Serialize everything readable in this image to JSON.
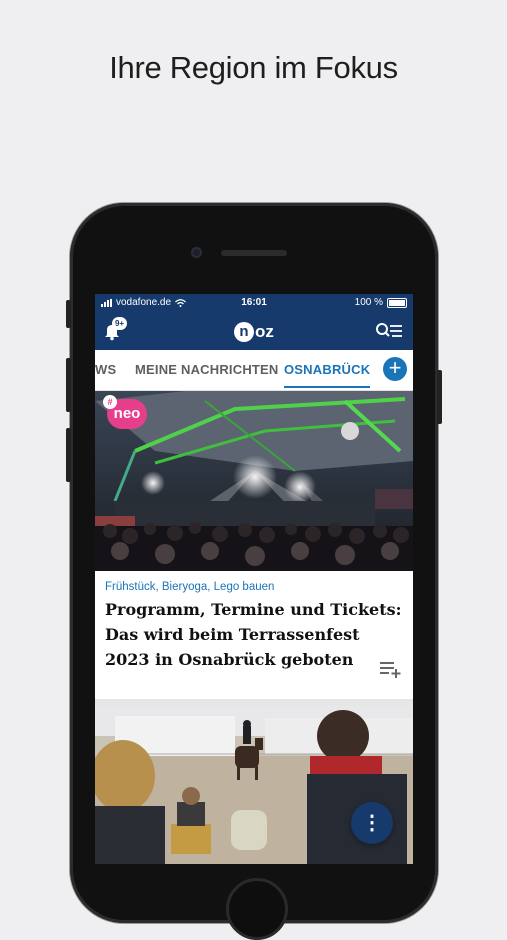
{
  "promo": {
    "headline": "Ihre Region im Fokus"
  },
  "status_bar": {
    "carrier": "vodafone.de",
    "time": "16:01",
    "battery": "100 %"
  },
  "app_bar": {
    "notification_badge": "9+",
    "logo_letter": "n",
    "logo_rest": "oz"
  },
  "tabs": [
    {
      "label": "NEWS",
      "visible_label": "WS",
      "active": false
    },
    {
      "label": "MEINE NACHRICHTEN",
      "active": false
    },
    {
      "label": "OSNABRÜCK",
      "active": true
    }
  ],
  "add_tab_label": "+",
  "hero": {
    "brand_badge": "neo",
    "brand_hash": "#"
  },
  "article": {
    "kicker": "Frühstück, Bieryoga, Lego bauen",
    "title": "Programm, Termine und Tickets: Das wird beim Terrassenfest 2023 in Osnabrück geboten"
  },
  "fab_label": "⋮",
  "colors": {
    "brand_navy": "#163a6b",
    "accent_blue": "#1a74b8",
    "neo_pink": "#e53f8c"
  },
  "icons": [
    "bell-icon",
    "search-list-icon",
    "plus-icon",
    "watchlist-add-icon",
    "more-vertical-icon",
    "wifi-icon",
    "signal-icon",
    "battery-icon"
  ]
}
